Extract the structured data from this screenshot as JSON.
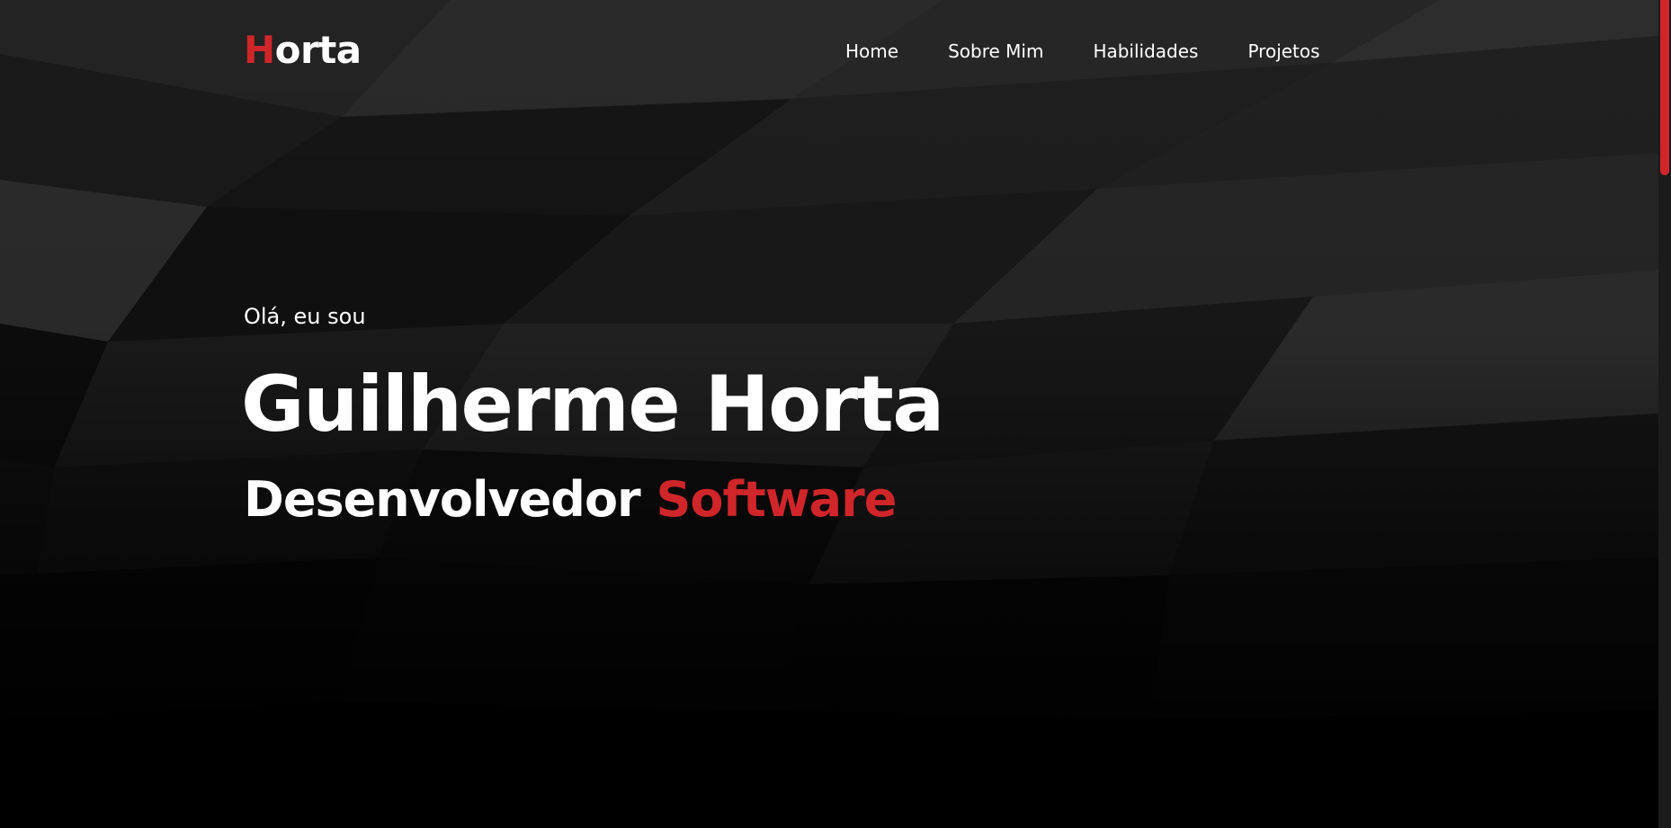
{
  "header": {
    "logo_first_letter": "H",
    "logo_rest": "orta",
    "nav": [
      {
        "label": "Home"
      },
      {
        "label": "Sobre Mim"
      },
      {
        "label": "Habilidades"
      },
      {
        "label": "Projetos"
      }
    ]
  },
  "hero": {
    "greeting": "Olá, eu sou",
    "name": "Guilherme Horta",
    "role_prefix": "Desenvolvedor",
    "role_highlight": "Software",
    "background": "dark-low-poly-pattern"
  },
  "colors": {
    "accent": "#d0262a",
    "background": "#000000",
    "text": "#ffffff"
  }
}
